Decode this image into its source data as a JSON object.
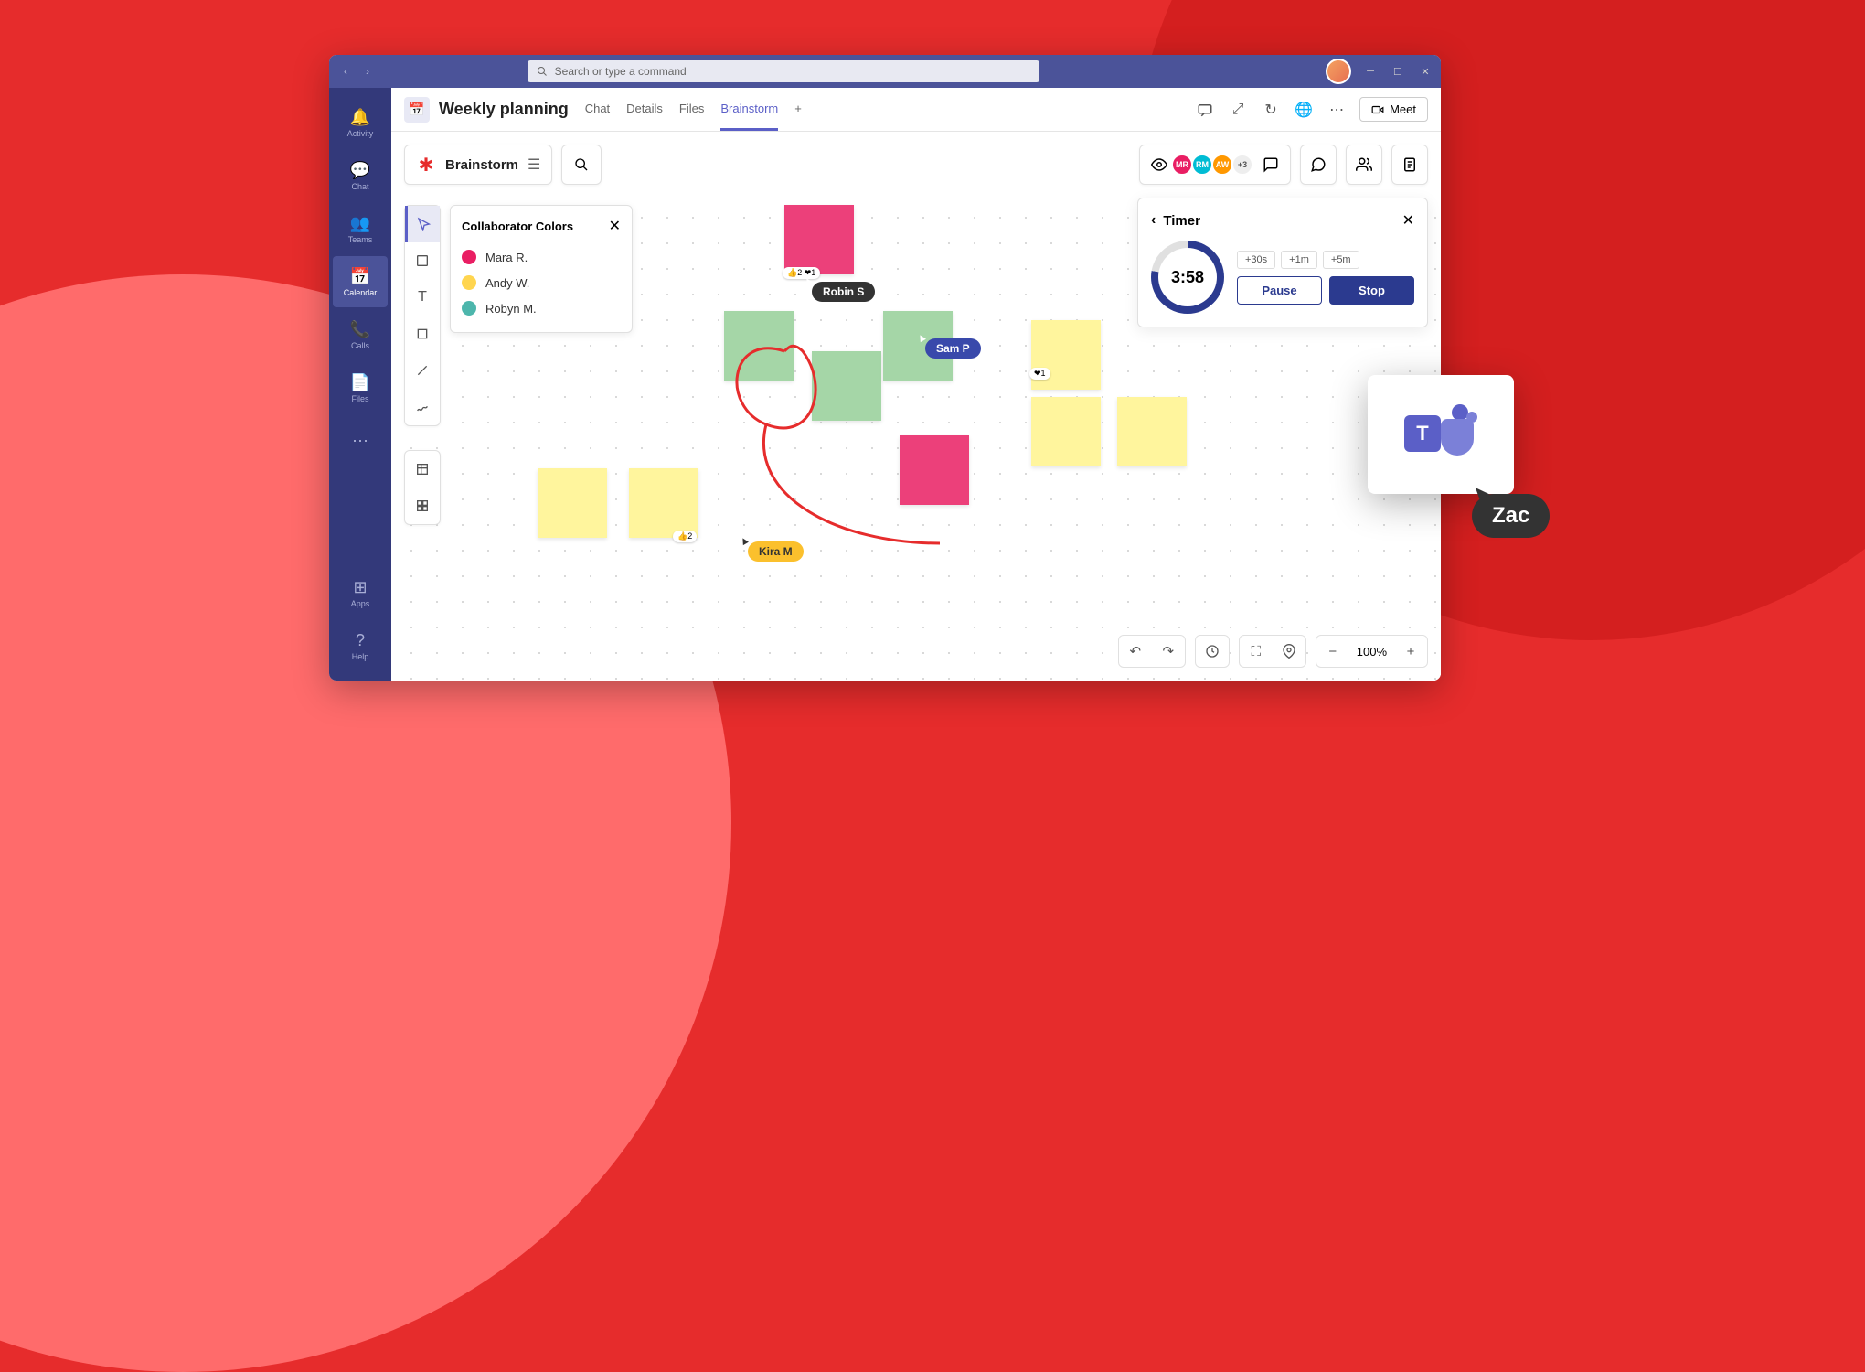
{
  "search": {
    "placeholder": "Search or type a command"
  },
  "leftnav": [
    {
      "label": "Activity"
    },
    {
      "label": "Chat"
    },
    {
      "label": "Teams"
    },
    {
      "label": "Calendar"
    },
    {
      "label": "Calls"
    },
    {
      "label": "Files"
    },
    {
      "label": "Apps"
    },
    {
      "label": "Help"
    }
  ],
  "header": {
    "title": "Weekly planning",
    "tabs": [
      "Chat",
      "Details",
      "Files",
      "Brainstorm"
    ],
    "meet": "Meet"
  },
  "doc": {
    "title": "Brainstorm"
  },
  "presence": {
    "avatars": [
      {
        "initials": "MR",
        "color": "#e91e63"
      },
      {
        "initials": "RM",
        "color": "#00bcd4"
      },
      {
        "initials": "AW",
        "color": "#ff9800"
      }
    ],
    "more": "+3"
  },
  "collab": {
    "title": "Collaborator Colors",
    "items": [
      {
        "name": "Mara R.",
        "color": "#e91e63"
      },
      {
        "name": "Andy W.",
        "color": "#ffd54f"
      },
      {
        "name": "Robyn M.",
        "color": "#4db6ac"
      }
    ]
  },
  "cursors": {
    "robin": "Robin S",
    "sam": "Sam P",
    "kira": "Kira M",
    "zac": "Zac"
  },
  "reactions": {
    "pink_top": "👍2 ❤1",
    "yellow_right": "❤1",
    "yellow_bottom": "👍2"
  },
  "timer": {
    "title": "Timer",
    "value": "3:58",
    "adds": [
      "+30s",
      "+1m",
      "+5m"
    ],
    "pause": "Pause",
    "stop": "Stop"
  },
  "zoom": "100%"
}
